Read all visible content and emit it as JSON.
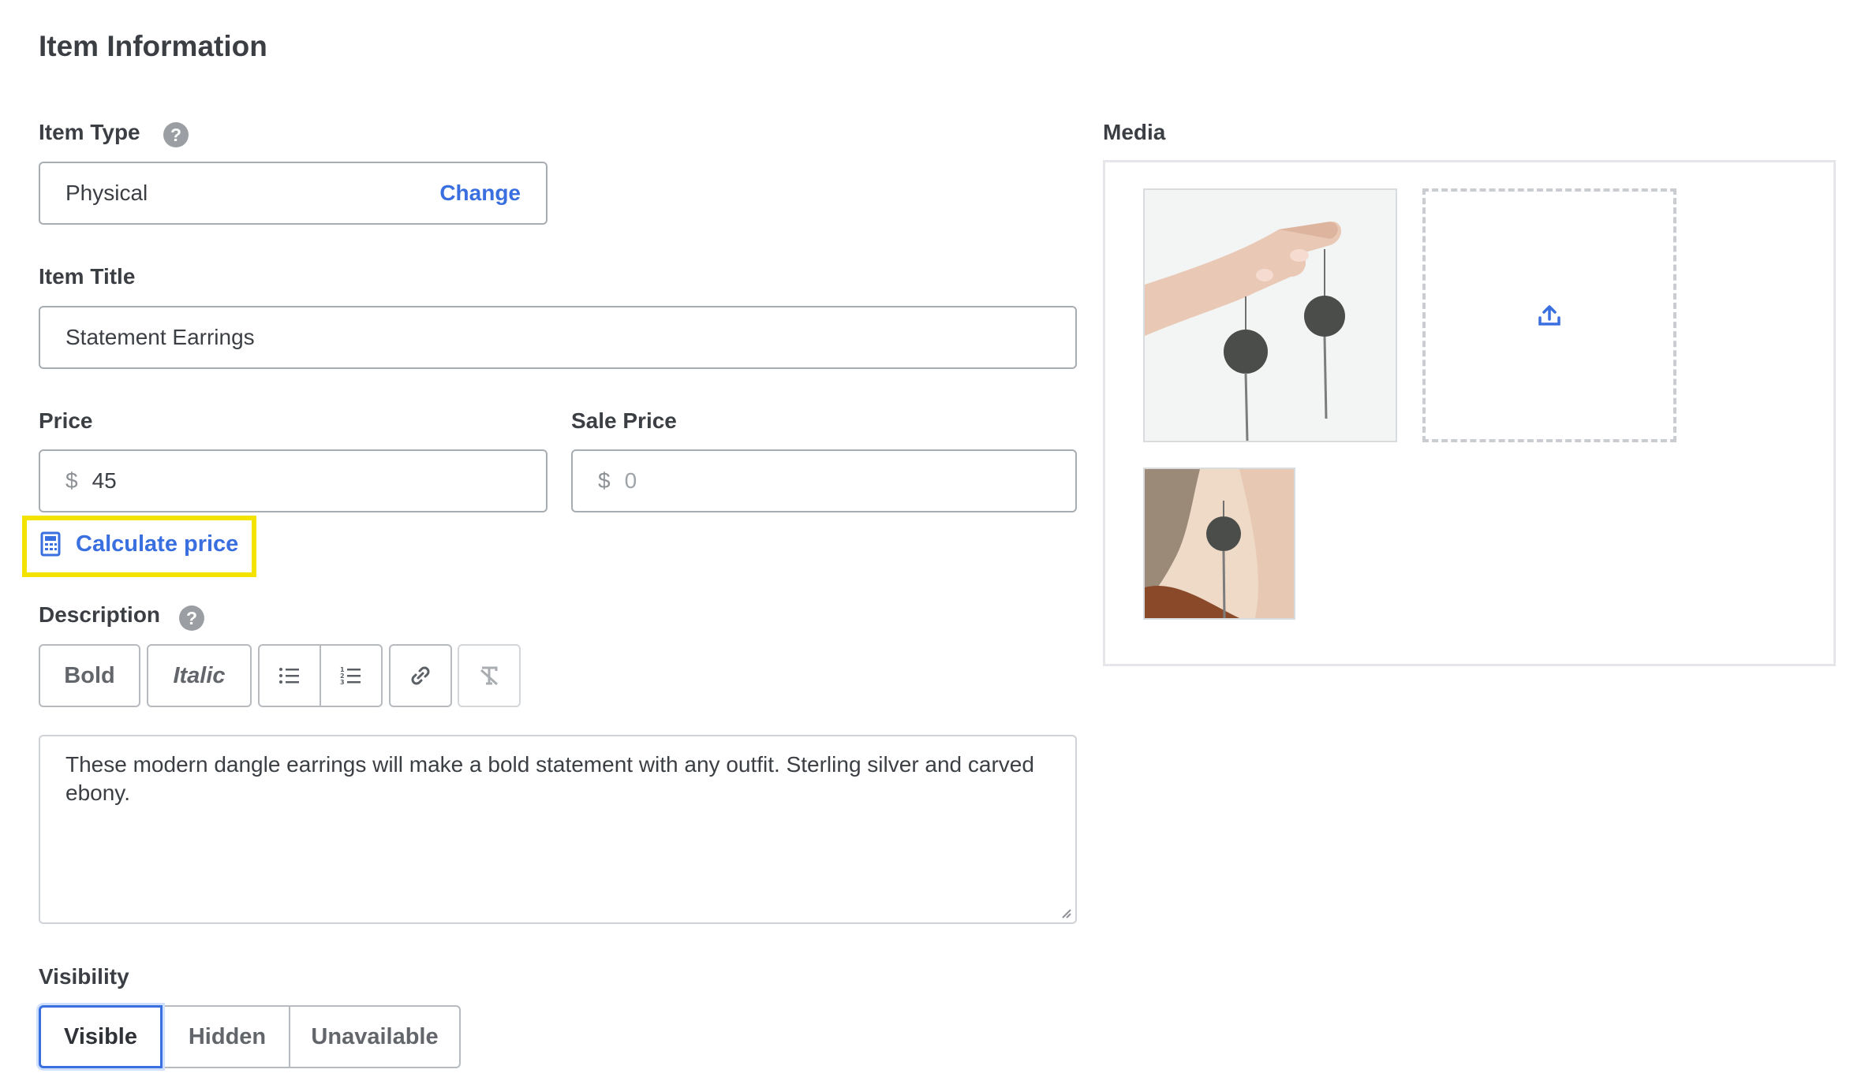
{
  "page": {
    "title": "Item Information"
  },
  "item_type": {
    "label": "Item Type",
    "help_icon": "?",
    "value": "Physical",
    "change_link": "Change"
  },
  "item_title": {
    "label": "Item Title",
    "value": "Statement Earrings"
  },
  "price": {
    "label": "Price",
    "currency": "$",
    "value": "45"
  },
  "sale_price": {
    "label": "Sale Price",
    "currency": "$",
    "placeholder": "0"
  },
  "calculate_price": {
    "label": "Calculate price",
    "icon": "calculator-icon"
  },
  "description": {
    "label": "Description",
    "help_icon": "?",
    "toolbar": {
      "bold": "Bold",
      "italic": "Italic",
      "bullet_list_icon": "bullet-list-icon",
      "numbered_list_icon": "numbered-list-icon",
      "link_icon": "link-icon",
      "clear_format_icon": "clear-format-icon"
    },
    "text": "These modern dangle earrings will make a bold statement with any outfit. Sterling silver and carved ebony."
  },
  "visibility": {
    "label": "Visibility",
    "options": [
      "Visible",
      "Hidden",
      "Unavailable"
    ],
    "selected": "Visible"
  },
  "media": {
    "label": "Media",
    "upload_icon": "upload-icon"
  },
  "colors": {
    "link": "#3a6fe0",
    "highlight": "#f4e200",
    "border": "#a8adb2",
    "text": "#3b3f44"
  }
}
